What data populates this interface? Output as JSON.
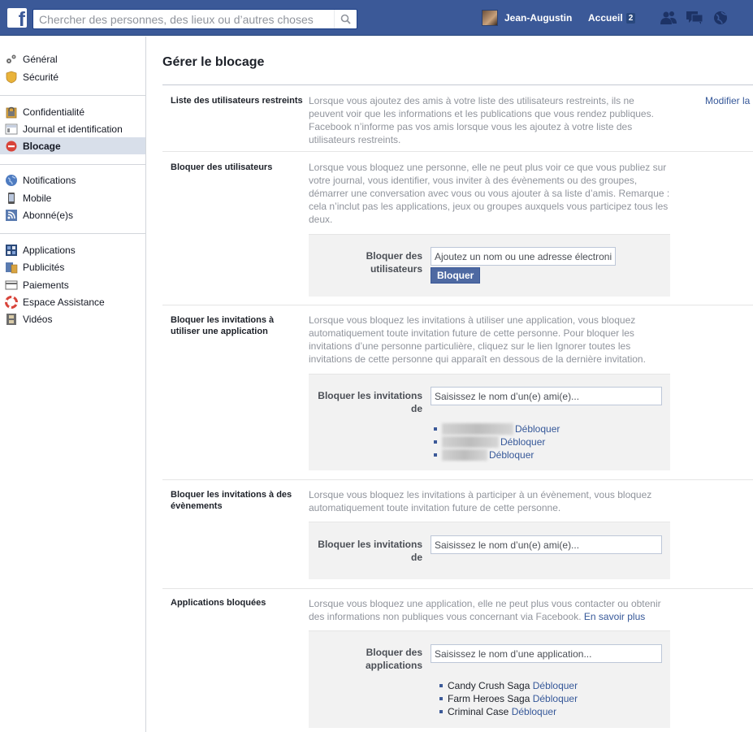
{
  "topbar": {
    "logo_letter": "f",
    "search_placeholder": "Chercher des personnes, des lieux ou d’autres choses",
    "user_name": "Jean-Augustin",
    "home_label": "Accueil",
    "home_count": "2"
  },
  "sidebar": {
    "items": [
      {
        "label": "Général",
        "icon": "gear-icon"
      },
      {
        "label": "Sécurité",
        "icon": "shield-icon"
      },
      {
        "label": "Confidentialité",
        "icon": "lock-icon"
      },
      {
        "label": "Journal et identification",
        "icon": "timeline-icon"
      },
      {
        "label": "Blocage",
        "icon": "block-icon"
      },
      {
        "label": "Notifications",
        "icon": "globe-icon"
      },
      {
        "label": "Mobile",
        "icon": "mobile-icon"
      },
      {
        "label": "Abonné(e)s",
        "icon": "rss-icon"
      },
      {
        "label": "Applications",
        "icon": "apps-icon"
      },
      {
        "label": "Publicités",
        "icon": "ads-icon"
      },
      {
        "label": "Paiements",
        "icon": "card-icon"
      },
      {
        "label": "Espace Assistance",
        "icon": "lifebuoy-icon"
      },
      {
        "label": "Vidéos",
        "icon": "film-icon"
      }
    ]
  },
  "main": {
    "title": "Gérer le blocage",
    "restricted": {
      "title": "Liste des utilisateurs restreints",
      "desc": "Lorsque vous ajoutez des amis à votre liste des utilisateurs restreints, ils ne peuvent voir que les informations et les publications que vous rendez publiques. Facebook n’informe pas vos amis lorsque vous les ajoutez à votre liste des utilisateurs restreints.",
      "modify": "Modifier la"
    },
    "block_users": {
      "title": "Bloquer des utilisateurs",
      "desc": "Lorsque vous bloquez une personne, elle ne peut plus voir ce que vous publiez sur votre journal, vous identifier, vous inviter à des évènements ou des groupes, démarrer une conversation avec vous ou vous ajouter à sa liste d’amis. Remarque : cela n’inclut pas les applications, jeux ou groupes auxquels vous participez tous les deux.",
      "label": "Bloquer des utilisateurs",
      "placeholder": "Ajoutez un nom ou une adresse électronique",
      "button": "Bloquer"
    },
    "app_invites": {
      "title": "Bloquer les invitations à utiliser une application",
      "desc": "Lorsque vous bloquez les invitations à utiliser une application, vous bloquez automatiquement toute invitation future de cette personne. Pour bloquer les invitations d’une personne particulière, cliquez sur le lien Ignorer toutes les invitations de cette personne qui apparaît en dessous de la dernière invitation.",
      "label": "Bloquer les invitations de",
      "placeholder": "Saisissez le nom d’un(e) ami(e)...",
      "unblock": "Débloquer"
    },
    "event_invites": {
      "title": "Bloquer les invitations à des évènements",
      "desc": "Lorsque vous bloquez les invitations à participer à un évènement, vous bloquez automatiquement toute invitation future de cette personne.",
      "label": "Bloquer les invitations de",
      "placeholder": "Saisissez le nom d’un(e) ami(e)..."
    },
    "blocked_apps": {
      "title": "Applications bloquées",
      "desc": "Lorsque vous bloquez une application, elle ne peut plus vous contacter ou obtenir des informations non publiques vous concernant via Facebook.",
      "learn_more": "En savoir plus",
      "label": "Bloquer des applications",
      "placeholder": "Saisissez le nom d’une application...",
      "unblock": "Débloquer",
      "apps": [
        "Candy Crush Saga",
        "Farm Heroes Saga",
        "Criminal Case"
      ]
    }
  },
  "colors": {
    "topbar": "#3b5998",
    "link": "#365899",
    "active_bg": "#d8dfea"
  }
}
